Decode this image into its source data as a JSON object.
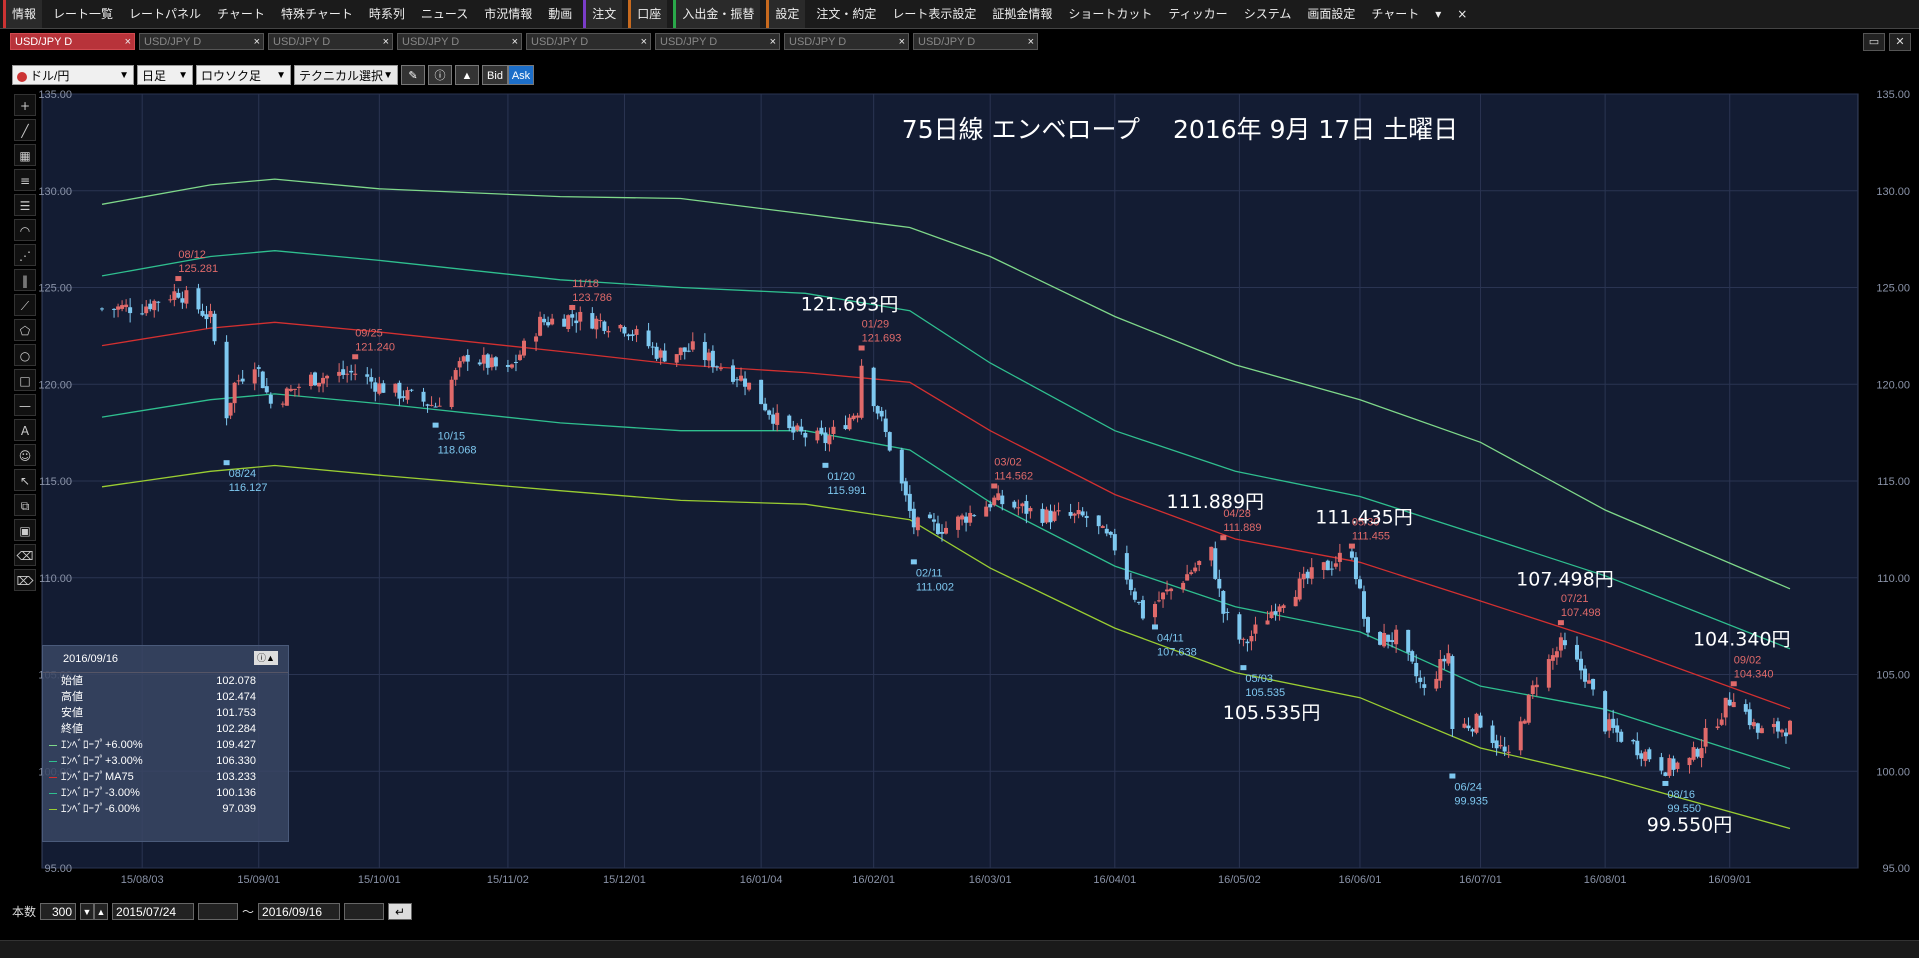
{
  "menu": {
    "items": [
      "情報",
      "レート一覧",
      "レートパネル",
      "チャート",
      "特殊チャート",
      "時系列",
      "ニュース",
      "市況情報",
      "動画",
      "注文",
      "口座",
      "入出金・振替",
      "設定",
      "注文・約定",
      "レート表示設定",
      "証拠金情報",
      "ショートカット",
      "ティッカー",
      "システム",
      "画面設定",
      "チャート"
    ],
    "more_glyph": "▾",
    "close_glyph": "×"
  },
  "tabs": [
    "USD/JPY D",
    "USD/JPY D",
    "USD/JPY D",
    "USD/JPY D",
    "USD/JPY D",
    "USD/JPY D",
    "USD/JPY D",
    "USD/JPY D"
  ],
  "tab_close": "×",
  "toolbar": {
    "pair": "ドル/円",
    "period": "日足",
    "chart_style": "ロウソク足",
    "technical": "テクニカル選択",
    "bid": "Bid",
    "ask": "Ask"
  },
  "title": "75日線 エンベロープ　 2016年 9月 17日 土曜日",
  "info": {
    "date": "2016/09/16",
    "rows": [
      {
        "label": "始値",
        "value": "102.078",
        "color": ""
      },
      {
        "label": "高値",
        "value": "102.474",
        "color": ""
      },
      {
        "label": "安値",
        "value": "101.753",
        "color": ""
      },
      {
        "label": "終値",
        "value": "102.284",
        "color": ""
      },
      {
        "label": "ｴﾝﾍﾞﾛｰﾌﾟ+6.00%",
        "value": "109.427",
        "color": "#7fd88a"
      },
      {
        "label": "ｴﾝﾍﾞﾛｰﾌﾟ+3.00%",
        "value": "106.330",
        "color": "#2fbf8f"
      },
      {
        "label": "ｴﾝﾍﾞﾛｰﾌﾟMA75",
        "value": "103.233",
        "color": "#d33030"
      },
      {
        "label": "ｴﾝﾍﾞﾛｰﾌﾟ-3.00%",
        "value": "100.136",
        "color": "#2fbf8f"
      },
      {
        "label": "ｴﾝﾍﾞﾛｰﾌﾟ-6.00%",
        "value": "97.039",
        "color": "#9acd32"
      }
    ]
  },
  "bottom": {
    "count_label": "本数",
    "count": "300",
    "from": "2015/07/24",
    "tilde": "〜",
    "to": "2016/09/16"
  },
  "chart_data": {
    "type": "candlestick",
    "ylim": [
      95.0,
      135.0
    ],
    "yticks": [
      "95.00",
      "100.00",
      "105.00",
      "110.00",
      "115.00",
      "120.00",
      "125.00",
      "130.00",
      "135.00"
    ],
    "xticks": [
      {
        "label": "15/08/03",
        "date": "2015-08-03"
      },
      {
        "label": "15/09/01",
        "date": "2015-09-01"
      },
      {
        "label": "15/10/01",
        "date": "2015-10-01"
      },
      {
        "label": "15/11/02",
        "date": "2015-11-02"
      },
      {
        "label": "15/12/01",
        "date": "2015-12-01"
      },
      {
        "label": "16/01/04",
        "date": "2016-01-04"
      },
      {
        "label": "16/02/01",
        "date": "2016-02-01"
      },
      {
        "label": "16/03/01",
        "date": "2016-03-01"
      },
      {
        "label": "16/04/01",
        "date": "2016-04-01"
      },
      {
        "label": "16/05/02",
        "date": "2016-05-02"
      },
      {
        "label": "16/06/01",
        "date": "2016-06-01"
      },
      {
        "label": "16/07/01",
        "date": "2016-07-01"
      },
      {
        "label": "16/08/01",
        "date": "2016-08-01"
      },
      {
        "label": "16/09/01",
        "date": "2016-09-01"
      }
    ],
    "x_range": [
      "2015-07-24",
      "2016-09-16"
    ],
    "close_anchors": [
      [
        "2015-07-24",
        123.9
      ],
      [
        "2015-08-03",
        124.0
      ],
      [
        "2015-08-12",
        124.8
      ],
      [
        "2015-08-20",
        123.4
      ],
      [
        "2015-08-24",
        118.5
      ],
      [
        "2015-08-26",
        120.0
      ],
      [
        "2015-08-31",
        121.2
      ],
      [
        "2015-09-04",
        119.0
      ],
      [
        "2015-09-14",
        120.3
      ],
      [
        "2015-09-25",
        120.6
      ],
      [
        "2015-10-01",
        119.9
      ],
      [
        "2015-10-15",
        118.9
      ],
      [
        "2015-10-23",
        121.5
      ],
      [
        "2015-11-02",
        120.6
      ],
      [
        "2015-11-10",
        123.2
      ],
      [
        "2015-11-18",
        123.5
      ],
      [
        "2015-12-01",
        123.0
      ],
      [
        "2015-12-10",
        121.5
      ],
      [
        "2015-12-18",
        121.8
      ],
      [
        "2015-12-31",
        120.2
      ],
      [
        "2016-01-10",
        117.6
      ],
      [
        "2016-01-20",
        117.1
      ],
      [
        "2016-01-28",
        118.7
      ],
      [
        "2016-01-29",
        121.1
      ],
      [
        "2016-02-05",
        116.8
      ],
      [
        "2016-02-11",
        112.7
      ],
      [
        "2016-02-19",
        112.6
      ],
      [
        "2016-03-02",
        114.0
      ],
      [
        "2016-03-15",
        113.2
      ],
      [
        "2016-03-25",
        113.1
      ],
      [
        "2016-04-01",
        111.6
      ],
      [
        "2016-04-08",
        108.1
      ],
      [
        "2016-04-25",
        111.3
      ],
      [
        "2016-04-28",
        108.2
      ],
      [
        "2016-05-03",
        106.5
      ],
      [
        "2016-05-12",
        108.8
      ],
      [
        "2016-05-20",
        110.1
      ],
      [
        "2016-05-30",
        111.4
      ],
      [
        "2016-06-03",
        106.8
      ],
      [
        "2016-06-10",
        106.9
      ],
      [
        "2016-06-17",
        104.1
      ],
      [
        "2016-06-23",
        106.1
      ],
      [
        "2016-06-24",
        102.2
      ],
      [
        "2016-07-01",
        102.6
      ],
      [
        "2016-07-08",
        100.6
      ],
      [
        "2016-07-15",
        104.8
      ],
      [
        "2016-07-21",
        106.5
      ],
      [
        "2016-07-27",
        105.0
      ],
      [
        "2016-08-01",
        102.4
      ],
      [
        "2016-08-05",
        101.8
      ],
      [
        "2016-08-16",
        100.2
      ],
      [
        "2016-08-22",
        100.5
      ],
      [
        "2016-08-26",
        101.8
      ],
      [
        "2016-09-02",
        104.0
      ],
      [
        "2016-09-08",
        102.0
      ],
      [
        "2016-09-16",
        102.284
      ]
    ],
    "envelopes": [
      {
        "name": "ｴﾝﾍﾞﾛｰﾌﾟ+6.00%",
        "color": "#7fd88a",
        "values": [
          [
            "2015-07-24",
            129.3
          ],
          [
            "2015-08-20",
            130.3
          ],
          [
            "2015-09-05",
            130.6
          ],
          [
            "2015-10-01",
            130.1
          ],
          [
            "2015-11-15",
            129.7
          ],
          [
            "2015-12-15",
            129.6
          ],
          [
            "2016-01-15",
            128.8
          ],
          [
            "2016-02-10",
            128.1
          ],
          [
            "2016-03-01",
            126.6
          ],
          [
            "2016-04-01",
            123.5
          ],
          [
            "2016-05-01",
            121.0
          ],
          [
            "2016-06-01",
            119.2
          ],
          [
            "2016-07-01",
            117.0
          ],
          [
            "2016-08-01",
            113.5
          ],
          [
            "2016-09-16",
            109.427
          ]
        ]
      },
      {
        "name": "ｴﾝﾍﾞﾛｰﾌﾟ+3.00%",
        "color": "#2fbf8f",
        "values": [
          [
            "2015-07-24",
            125.6
          ],
          [
            "2015-08-20",
            126.6
          ],
          [
            "2015-09-05",
            126.9
          ],
          [
            "2015-10-01",
            126.4
          ],
          [
            "2015-11-15",
            125.4
          ],
          [
            "2015-12-15",
            125.0
          ],
          [
            "2016-01-15",
            124.7
          ],
          [
            "2016-02-10",
            123.8
          ],
          [
            "2016-03-01",
            121.1
          ],
          [
            "2016-04-01",
            117.6
          ],
          [
            "2016-05-01",
            115.5
          ],
          [
            "2016-06-01",
            114.2
          ],
          [
            "2016-07-01",
            112.2
          ],
          [
            "2016-08-01",
            110.1
          ],
          [
            "2016-09-16",
            106.33
          ]
        ]
      },
      {
        "name": "ｴﾝﾍﾞﾛｰﾌﾟMA75",
        "color": "#d33030",
        "values": [
          [
            "2015-07-24",
            122.0
          ],
          [
            "2015-08-20",
            122.9
          ],
          [
            "2015-09-05",
            123.2
          ],
          [
            "2015-10-01",
            122.7
          ],
          [
            "2015-11-15",
            121.7
          ],
          [
            "2015-12-15",
            121.0
          ],
          [
            "2016-01-15",
            120.6
          ],
          [
            "2016-02-10",
            120.1
          ],
          [
            "2016-03-01",
            117.6
          ],
          [
            "2016-04-01",
            114.3
          ],
          [
            "2016-05-01",
            112.0
          ],
          [
            "2016-06-01",
            110.8
          ],
          [
            "2016-07-01",
            108.8
          ],
          [
            "2016-08-01",
            106.7
          ],
          [
            "2016-09-16",
            103.233
          ]
        ]
      },
      {
        "name": "ｴﾝﾍﾞﾛｰﾌﾟ-3.00%",
        "color": "#2fbf8f",
        "values": [
          [
            "2015-07-24",
            118.3
          ],
          [
            "2015-08-20",
            119.2
          ],
          [
            "2015-09-05",
            119.5
          ],
          [
            "2015-10-01",
            119.0
          ],
          [
            "2015-11-15",
            118.0
          ],
          [
            "2015-12-15",
            117.6
          ],
          [
            "2016-01-15",
            117.6
          ],
          [
            "2016-02-10",
            116.6
          ],
          [
            "2016-03-01",
            113.9
          ],
          [
            "2016-04-01",
            110.6
          ],
          [
            "2016-05-01",
            108.5
          ],
          [
            "2016-06-01",
            107.2
          ],
          [
            "2016-07-01",
            104.4
          ],
          [
            "2016-08-01",
            103.2
          ],
          [
            "2016-09-16",
            100.136
          ]
        ]
      },
      {
        "name": "ｴﾝﾍﾞﾛｰﾌﾟ-6.00%",
        "color": "#9acd32",
        "values": [
          [
            "2015-07-24",
            114.7
          ],
          [
            "2015-08-20",
            115.5
          ],
          [
            "2015-09-05",
            115.8
          ],
          [
            "2015-10-01",
            115.3
          ],
          [
            "2015-11-15",
            114.5
          ],
          [
            "2015-12-15",
            114.0
          ],
          [
            "2016-01-15",
            113.8
          ],
          [
            "2016-02-10",
            113.0
          ],
          [
            "2016-03-01",
            110.5
          ],
          [
            "2016-04-01",
            107.4
          ],
          [
            "2016-05-01",
            105.1
          ],
          [
            "2016-06-01",
            103.8
          ],
          [
            "2016-07-01",
            101.2
          ],
          [
            "2016-08-01",
            99.7
          ],
          [
            "2016-09-16",
            97.039
          ]
        ]
      }
    ],
    "highs": [
      {
        "date": "08/12",
        "value": "125.281",
        "anchor": "2015-08-12",
        "y": 125.281
      },
      {
        "date": "09/25",
        "value": "121.240",
        "anchor": "2015-09-25",
        "y": 121.24
      },
      {
        "date": "11/18",
        "value": "123.786",
        "anchor": "2015-11-18",
        "y": 123.786
      },
      {
        "date": "01/29",
        "value": "121.693",
        "anchor": "2016-01-29",
        "y": 121.693
      },
      {
        "date": "03/02",
        "value": "114.562",
        "anchor": "2016-03-02",
        "y": 114.562
      },
      {
        "date": "04/28",
        "value": "111.889",
        "anchor": "2016-04-28",
        "y": 111.889
      },
      {
        "date": "05/30",
        "value": "111.455",
        "anchor": "2016-05-30",
        "y": 111.455
      },
      {
        "date": "07/21",
        "value": "107.498",
        "anchor": "2016-07-21",
        "y": 107.498
      },
      {
        "date": "09/02",
        "value": "104.340",
        "anchor": "2016-09-02",
        "y": 104.34
      }
    ],
    "lows": [
      {
        "date": "08/24",
        "value": "116.127",
        "anchor": "2015-08-24",
        "y": 116.127
      },
      {
        "date": "10/15",
        "value": "118.068",
        "anchor": "2015-10-15",
        "y": 118.068
      },
      {
        "date": "01/20",
        "value": "115.991",
        "anchor": "2016-01-20",
        "y": 115.991
      },
      {
        "date": "02/11",
        "value": "111.002",
        "anchor": "2016-02-11",
        "y": 111.002
      },
      {
        "date": "04/11",
        "value": "107.638",
        "anchor": "2016-04-11",
        "y": 107.638
      },
      {
        "date": "05/03",
        "value": "105.535",
        "anchor": "2016-05-03",
        "y": 105.535
      },
      {
        "date": "06/24",
        "value": "99.935",
        "anchor": "2016-06-24",
        "y": 99.935
      },
      {
        "date": "08/16",
        "value": "99.550",
        "anchor": "2016-08-16",
        "y": 99.55
      }
    ],
    "big_labels": [
      {
        "text": "121.693円",
        "anchor": "2016-01-26",
        "y": 123.8
      },
      {
        "text": "111.889円",
        "anchor": "2016-04-26",
        "y": 113.6
      },
      {
        "text": "111.435円",
        "anchor": "2016-06-02",
        "y": 112.8
      },
      {
        "text": "105.535円",
        "anchor": "2016-05-10",
        "y": 102.7
      },
      {
        "text": "107.498円",
        "anchor": "2016-07-22",
        "y": 109.6
      },
      {
        "text": "104.340円",
        "anchor": "2016-09-04",
        "y": 106.5
      },
      {
        "text": "99.550円",
        "anchor": "2016-08-22",
        "y": 96.9
      }
    ]
  }
}
